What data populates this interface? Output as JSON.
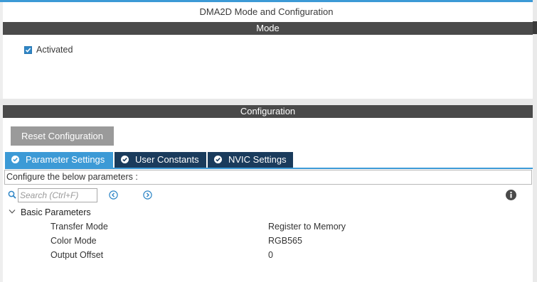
{
  "window": {
    "title": "DMA2D Mode and Configuration"
  },
  "mode": {
    "section_title": "Mode",
    "activated": {
      "label": "Activated",
      "checked": true
    }
  },
  "configuration": {
    "section_title": "Configuration",
    "reset_button": "Reset Configuration",
    "tabs": [
      {
        "label": "Parameter Settings",
        "active": true
      },
      {
        "label": "User Constants",
        "active": false
      },
      {
        "label": "NVIC Settings",
        "active": false
      }
    ],
    "instructions": "Configure the below parameters :",
    "search": {
      "placeholder": "Search (Ctrl+F)"
    },
    "group": {
      "label": "Basic Parameters",
      "rows": [
        {
          "label": "Transfer Mode",
          "value": "Register to Memory"
        },
        {
          "label": "Color Mode",
          "value": "RGB565"
        },
        {
          "label": "Output Offset",
          "value": "0"
        }
      ]
    }
  },
  "colors": {
    "accent": "#3c9ad6",
    "tab_inactive": "#1a3b5c",
    "section_bar": "#4a4a4a",
    "reset_button": "#9a9a9a"
  },
  "icons": {
    "checkbox": "check-icon",
    "tab_tick": "check-circle-icon",
    "search": "search-icon",
    "prev": "arrow-left-circle-icon",
    "next": "arrow-right-circle-icon",
    "info": "info-icon",
    "tree_toggle": "chevron-down-icon"
  }
}
